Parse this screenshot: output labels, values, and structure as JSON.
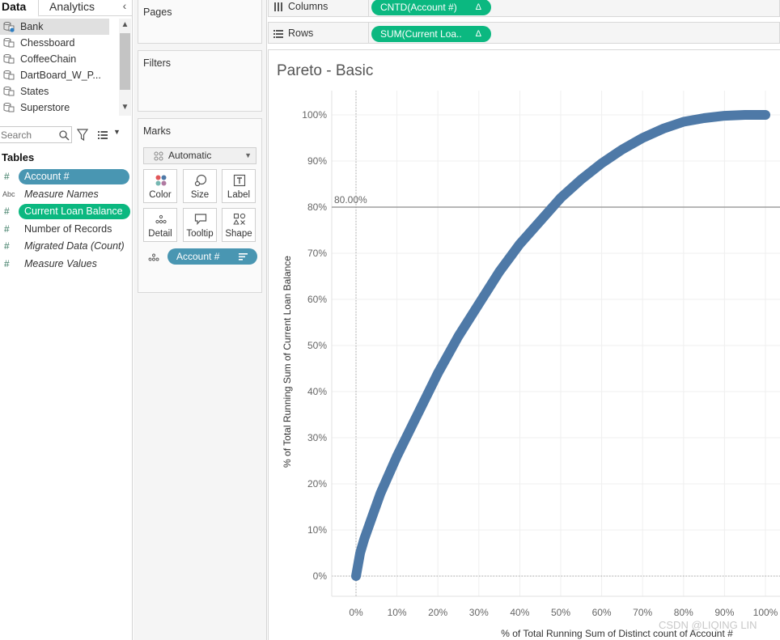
{
  "left_pane": {
    "tabs": {
      "data": "Data",
      "analytics": "Analytics"
    },
    "collapse_glyph": "‹",
    "data_sources": [
      {
        "label": "Bank",
        "selected": true
      },
      {
        "label": "Chessboard",
        "selected": false
      },
      {
        "label": "CoffeeChain",
        "selected": false
      },
      {
        "label": "DartBoard_W_P...",
        "selected": false
      },
      {
        "label": "States",
        "selected": false
      },
      {
        "label": "Superstore",
        "selected": false
      }
    ],
    "search_placeholder": "Search",
    "tables_heading": "Tables",
    "fields": [
      {
        "type": "#",
        "label": "Account #",
        "style": "pill-blue"
      },
      {
        "type": "Abc",
        "label": "Measure Names",
        "style": "italic"
      },
      {
        "type": "#",
        "label": "Current Loan Balance",
        "style": "pill-green"
      },
      {
        "type": "#",
        "label": "Number of Records",
        "style": "plain"
      },
      {
        "type": "#",
        "label": "Migrated Data (Count)",
        "style": "italic"
      },
      {
        "type": "#",
        "label": "Measure Values",
        "style": "italic"
      }
    ]
  },
  "cards": {
    "pages": "Pages",
    "filters": "Filters",
    "marks": "Marks",
    "mark_type": "Automatic",
    "mark_buttons": [
      "Color",
      "Size",
      "Label",
      "Detail",
      "Tooltip",
      "Shape"
    ],
    "detail_pill": "Account #"
  },
  "shelves": {
    "columns_label": "Columns",
    "columns_pill": "CNTD(Account #)",
    "rows_label": "Rows",
    "rows_pill": "SUM(Current Loa..",
    "delta_glyph": "Δ"
  },
  "viz": {
    "title": "Pareto - Basic",
    "watermark": "CSDN @LIQING LIN"
  },
  "colors": {
    "line": "#4e79a7",
    "pill_blue": "#4996b2",
    "pill_green": "#0bb880",
    "reference_line": "#8c8c8c"
  },
  "chart_data": {
    "type": "line",
    "title": "Pareto - Basic",
    "xlabel": "% of Total Running Sum of Distinct count of Account #",
    "ylabel": "% of Total Running Sum of Current Loan Balance",
    "x_ticks": [
      "0%",
      "10%",
      "20%",
      "30%",
      "40%",
      "50%",
      "60%",
      "70%",
      "80%",
      "90%",
      "100%"
    ],
    "y_ticks": [
      "0%",
      "10%",
      "20%",
      "30%",
      "40%",
      "50%",
      "60%",
      "70%",
      "80%",
      "90%",
      "100%"
    ],
    "xlim": [
      0,
      100
    ],
    "ylim": [
      0,
      100
    ],
    "reference_line": {
      "value": 80,
      "label": "80.00%"
    },
    "series": [
      {
        "x": [
          0,
          1,
          2,
          4,
          6,
          8,
          10,
          15,
          20,
          25,
          30,
          35,
          40,
          45,
          50,
          55,
          60,
          65,
          70,
          75,
          80,
          85,
          90,
          95,
          100
        ],
        "y": [
          0,
          5,
          8,
          13,
          18,
          22,
          26,
          35,
          44,
          52,
          59,
          66,
          72,
          77,
          82,
          86,
          89.5,
          92.5,
          95,
          97,
          98.5,
          99.3,
          99.8,
          100,
          100
        ]
      }
    ]
  }
}
